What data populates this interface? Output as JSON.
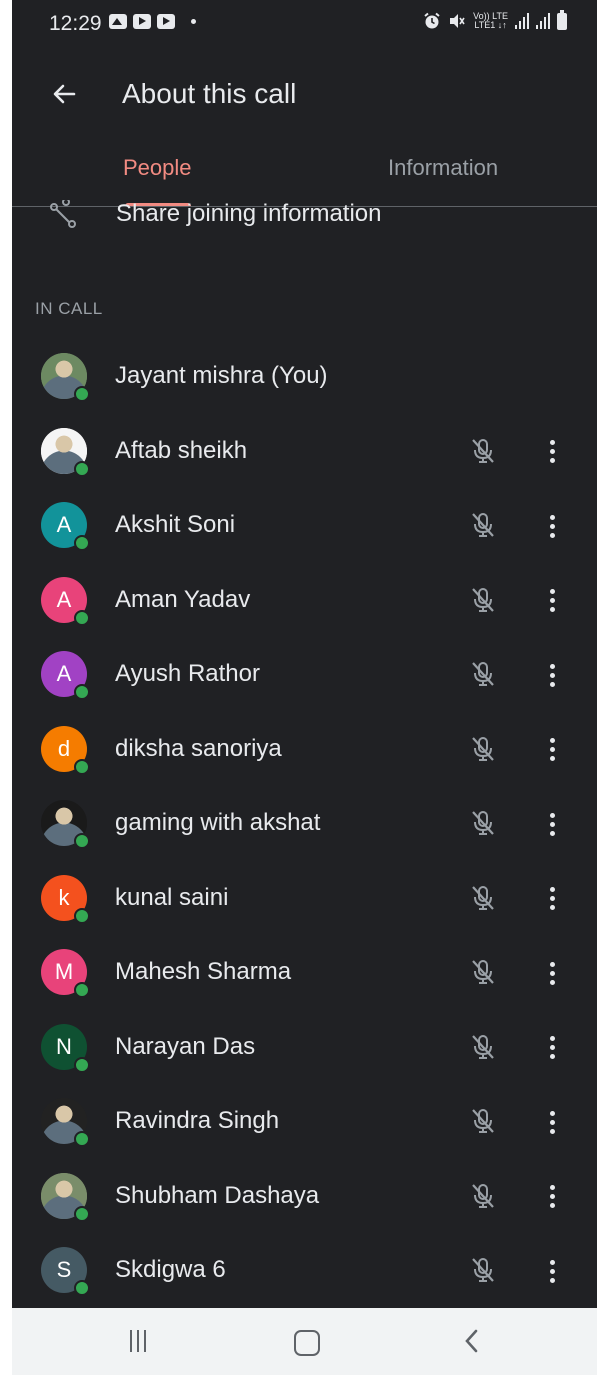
{
  "status_bar": {
    "time": "12:29",
    "net_top": "Vo)) LTE",
    "net_bottom": "LTE1 ↓↑"
  },
  "header": {
    "title": "About this call",
    "back_icon": "arrow-back-icon"
  },
  "tabs": [
    {
      "label": "People",
      "active": true
    },
    {
      "label": "Information",
      "active": false
    }
  ],
  "share": {
    "label": "Share joining information",
    "icon": "share-icon"
  },
  "section_label": "IN CALL",
  "participants": [
    {
      "name": "Jayant mishra (You)",
      "initial": "",
      "color": "#6d8a62",
      "photo": true,
      "mute_icon": false
    },
    {
      "name": "Aftab sheikh",
      "initial": "",
      "color": "#f5f5f5",
      "photo": true,
      "mute_icon": true
    },
    {
      "name": "Akshit Soni",
      "initial": "A",
      "color": "#12939a",
      "photo": false,
      "mute_icon": true
    },
    {
      "name": "Aman Yadav",
      "initial": "A",
      "color": "#e8437a",
      "photo": false,
      "mute_icon": true
    },
    {
      "name": "Ayush Rathor",
      "initial": "A",
      "color": "#a142c4",
      "photo": false,
      "mute_icon": true
    },
    {
      "name": "diksha sanoriya",
      "initial": "d",
      "color": "#f57c00",
      "photo": false,
      "mute_icon": true
    },
    {
      "name": "gaming with akshat",
      "initial": "",
      "color": "#1a1a1a",
      "photo": true,
      "mute_icon": true
    },
    {
      "name": "kunal saini",
      "initial": "k",
      "color": "#f4511e",
      "photo": false,
      "mute_icon": true
    },
    {
      "name": "Mahesh Sharma",
      "initial": "M",
      "color": "#e8437a",
      "photo": false,
      "mute_icon": true
    },
    {
      "name": "Narayan Das",
      "initial": "N",
      "color": "#0f5132",
      "photo": false,
      "mute_icon": true
    },
    {
      "name": "Ravindra Singh",
      "initial": "",
      "color": "#222222",
      "photo": true,
      "mute_icon": true
    },
    {
      "name": "Shubham Dashaya",
      "initial": "",
      "color": "#7a8d6a",
      "photo": true,
      "mute_icon": true
    },
    {
      "name": "Skdigwa 6",
      "initial": "S",
      "color": "#455a64",
      "photo": false,
      "mute_icon": true
    }
  ],
  "nav_bar": {
    "recents_icon": "recents-icon",
    "home_icon": "home-icon",
    "back_icon": "back-nav-icon"
  }
}
